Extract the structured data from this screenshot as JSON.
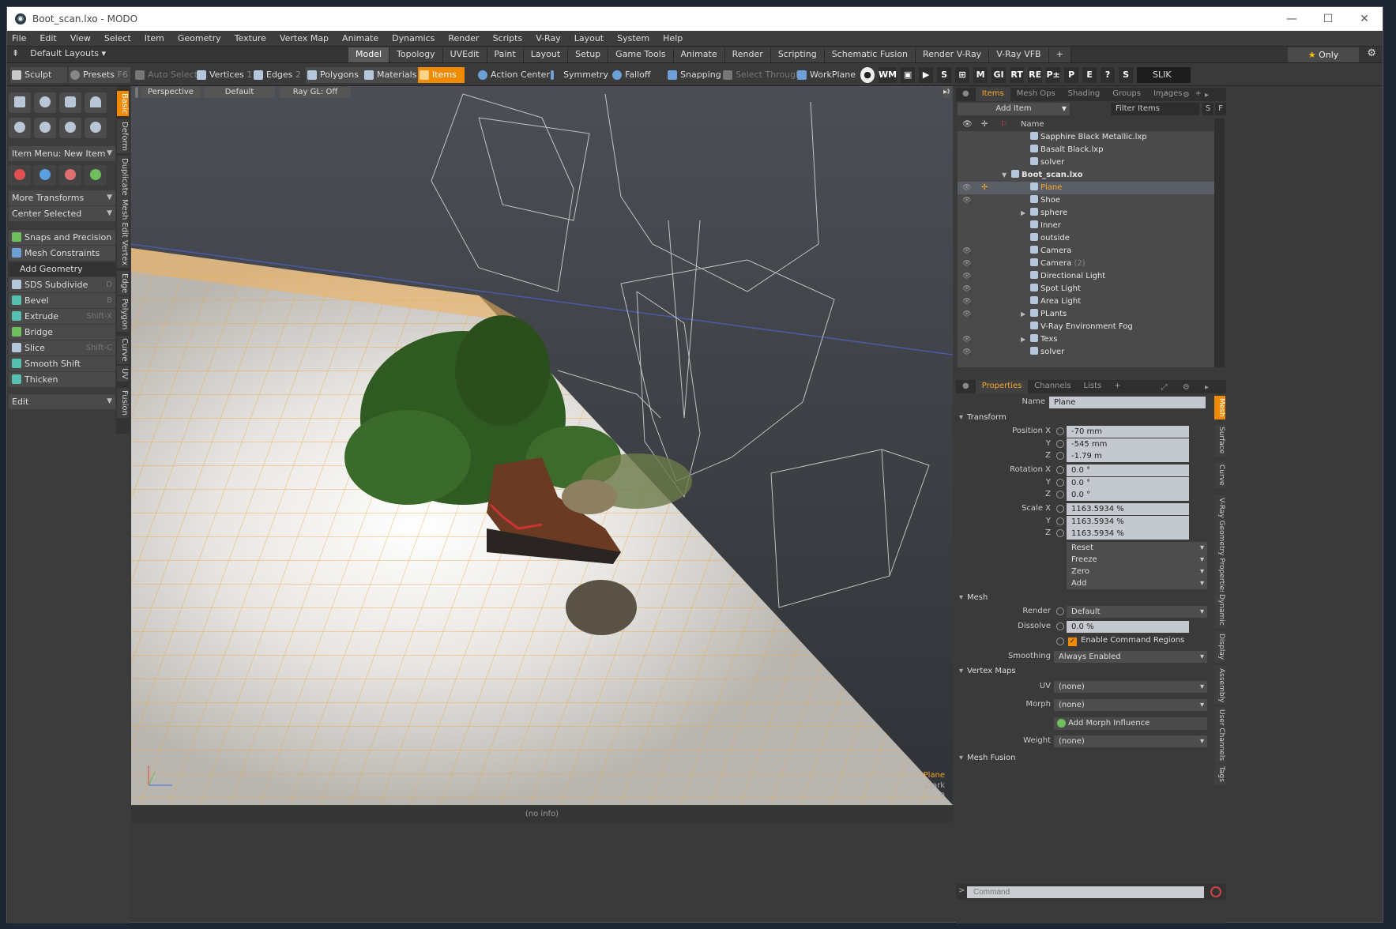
{
  "window": {
    "title": "Boot_scan.lxo - MODO",
    "app_icon": "modo-logo"
  },
  "menu": [
    "File",
    "Edit",
    "View",
    "Select",
    "Item",
    "Geometry",
    "Texture",
    "Vertex Map",
    "Animate",
    "Dynamics",
    "Render",
    "Scripts",
    "V-Ray",
    "Layout",
    "System",
    "Help"
  ],
  "layout_selector": "Default Layouts ▾",
  "layout_tabs": [
    {
      "label": "Model",
      "active": true
    },
    {
      "label": "Topology"
    },
    {
      "label": "UVEdit"
    },
    {
      "label": "Paint"
    },
    {
      "label": "Layout"
    },
    {
      "label": "Setup"
    },
    {
      "label": "Game Tools"
    },
    {
      "label": "Animate"
    },
    {
      "label": "Render"
    },
    {
      "label": "Scripting"
    },
    {
      "label": "Schematic Fusion"
    },
    {
      "label": "Render V-Ray"
    },
    {
      "label": "V-Ray VFB"
    },
    {
      "label": "+"
    }
  ],
  "only_button": "Only",
  "toolbar": {
    "sculpt": "Sculpt",
    "presets": "Presets",
    "presets_key": "F6",
    "auto_select": "Auto Select",
    "vertices": "Vertices",
    "vertices_key": "1",
    "edges": "Edges",
    "edges_key": "2",
    "polygons": "Polygons",
    "materials": "Materials",
    "items": "Items",
    "action_center": "Action Center",
    "symmetry": "Symmetry",
    "falloff": "Falloff",
    "snapping": "Snapping",
    "select_through": "Select Through",
    "workplane": "WorkPlane",
    "right_icons": [
      "WM",
      "M",
      "GI",
      "RT",
      "RE",
      "P±",
      "P",
      "E",
      "?",
      "S"
    ],
    "slik": "SLIK"
  },
  "left_panel": {
    "item_menu": "Item Menu: New Item",
    "more_transforms": "More Transforms",
    "center_selected": "Center Selected",
    "snaps": "Snaps and Precision",
    "mesh_constraints": "Mesh Constraints",
    "add_geometry": "Add Geometry",
    "tools": [
      {
        "label": "SDS Subdivide",
        "key": "D"
      },
      {
        "label": "Bevel",
        "key": "B"
      },
      {
        "label": "Extrude",
        "key": "Shift-X"
      },
      {
        "label": "Bridge",
        "key": ""
      },
      {
        "label": "Slice",
        "key": "Shift-C"
      },
      {
        "label": "Smooth Shift",
        "key": ""
      },
      {
        "label": "Thicken",
        "key": ""
      }
    ],
    "edit": "Edit",
    "vtabs": [
      "Basic",
      "Deform",
      "Duplicate",
      "Mesh Edit",
      "Vertex",
      "Edge",
      "Polygon",
      "Curve",
      "UV",
      "Fusion"
    ]
  },
  "viewport": {
    "view": "Perspective",
    "style": "Default",
    "raygl": "Ray GL: Off",
    "info_item": "Plane",
    "info_lines": [
      "Clark",
      "0"
    ],
    "status": "(no info)"
  },
  "items_panel": {
    "tabs": [
      "Items",
      "Mesh Ops",
      "Shading",
      "Groups",
      "Images",
      "+"
    ],
    "add_item": "Add Item",
    "filter": "Filter Items",
    "col_name": "Name",
    "rows": [
      {
        "label": "Sapphire Black Metallic.lxp",
        "indent": 3,
        "icon": "preset-icon"
      },
      {
        "label": "Basalt Black.lxp",
        "indent": 3,
        "icon": "preset-icon"
      },
      {
        "label": "solver",
        "indent": 3,
        "icon": "solver-icon"
      },
      {
        "label": "Boot_scan.lxo",
        "indent": 2,
        "icon": "scene-icon",
        "bold": true,
        "expanded": true
      },
      {
        "label": "Plane",
        "indent": 3,
        "icon": "mesh-icon",
        "selected": true,
        "eye": true,
        "lock": true
      },
      {
        "label": "Shoe",
        "indent": 3,
        "icon": "mesh-icon",
        "eye": true
      },
      {
        "label": "sphere",
        "indent": 3,
        "icon": "group-icon",
        "arrow": true
      },
      {
        "label": "Inner",
        "indent": 3,
        "icon": "mesh-icon"
      },
      {
        "label": "outside",
        "indent": 3,
        "icon": "mesh-icon"
      },
      {
        "label": "Camera",
        "indent": 3,
        "icon": "camera-icon",
        "eye": true
      },
      {
        "label": "Camera",
        "sub": "(2)",
        "indent": 3,
        "icon": "camera-icon",
        "eye": true
      },
      {
        "label": "Directional Light",
        "indent": 3,
        "icon": "light-icon",
        "eye": true
      },
      {
        "label": "Spot Light",
        "indent": 3,
        "icon": "light-icon",
        "eye": true
      },
      {
        "label": "Area Light",
        "indent": 3,
        "icon": "light-icon",
        "eye": true
      },
      {
        "label": "PLants",
        "indent": 3,
        "icon": "group-icon",
        "arrow": true,
        "eye": true
      },
      {
        "label": "V-Ray Environment Fog",
        "indent": 3,
        "icon": "fog-icon"
      },
      {
        "label": "Texs",
        "indent": 3,
        "icon": "group-icon",
        "arrow": true,
        "eye": true
      },
      {
        "label": "solver",
        "indent": 3,
        "icon": "solver-icon",
        "eye": true
      }
    ]
  },
  "properties": {
    "tabs": [
      "Properties",
      "Channels",
      "Lists",
      "+"
    ],
    "name_label": "Name",
    "name_value": "Plane",
    "transform": "Transform",
    "position_label": "Position X",
    "position": [
      "-70 mm",
      "-545 mm",
      "-1.79 m"
    ],
    "rotation_label": "Rotation X",
    "rotation": [
      "0.0 °",
      "0.0 °",
      "0.0 °"
    ],
    "scale_label": "Scale X",
    "scale": [
      "1163.5934 %",
      "1163.5934 %",
      "1163.5934 %"
    ],
    "axis_y": "Y",
    "axis_z": "Z",
    "actions": [
      "Reset",
      "Freeze",
      "Zero",
      "Add"
    ],
    "mesh": "Mesh",
    "render_label": "Render",
    "render_value": "Default",
    "dissolve_label": "Dissolve",
    "dissolve_value": "0.0 %",
    "enable_cmd": "Enable Command Regions",
    "smoothing_label": "Smoothing",
    "smoothing_value": "Always Enabled",
    "vertex_maps": "Vertex Maps",
    "uv_label": "UV",
    "uv_value": "(none)",
    "morph_label": "Morph",
    "morph_value": "(none)",
    "add_morph": "Add Morph Influence",
    "weight_label": "Weight",
    "weight_value": "(none)",
    "mesh_fusion": "Mesh Fusion",
    "vtabs": [
      "Mesh",
      "Surface",
      "Curve",
      "V-Ray Geometry Properties",
      "Dynamic",
      "Display",
      "Assembly",
      "User Channels",
      "Tags"
    ]
  },
  "command": {
    "placeholder": "Command"
  },
  "colors": {
    "accent": "#f08a00",
    "selection": "#f7a62a",
    "panel": "#3a3a3a"
  }
}
